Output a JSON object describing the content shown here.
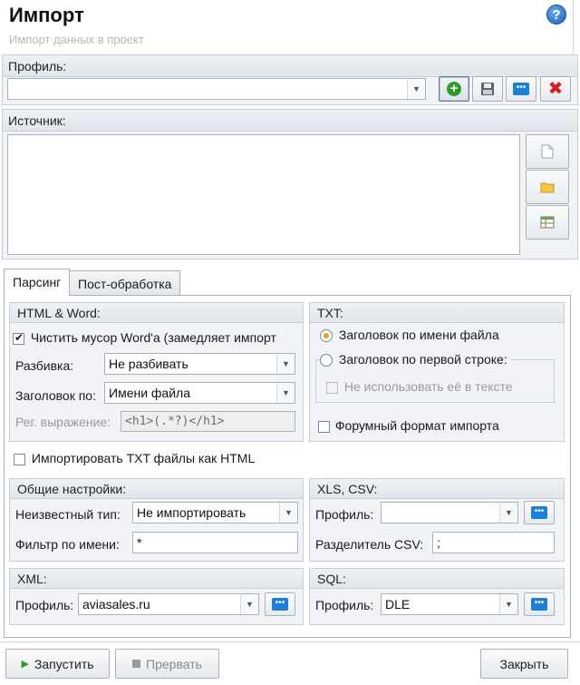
{
  "window": {
    "title": "Импорт",
    "subtitle": "Импорт данных в проект",
    "help_icon": "help-icon"
  },
  "profile": {
    "label": "Профиль:",
    "value": "",
    "buttons": [
      "add-icon",
      "save-icon",
      "more-icon",
      "delete-icon"
    ]
  },
  "source": {
    "label": "Источник:",
    "text": "",
    "buttons": [
      "new-file-icon",
      "open-folder-icon",
      "table-icon"
    ]
  },
  "tabs": {
    "parsing": "Парсинг",
    "post": "Пост-обработка"
  },
  "html_word": {
    "title": "HTML & Word:",
    "clean_label": "Чистить мусор Word'a (замедляет импорт",
    "clean_checked": true,
    "split_label": "Разбивка:",
    "split_value": "Не разбивать",
    "heading_label": "Заголовок по:",
    "heading_value": "Имени файла",
    "regex_label": "Рег. выражение:",
    "regex_value": "<h1>(.*?)</h1>"
  },
  "txt": {
    "title": "TXT:",
    "by_filename": "Заголовок по имени файла",
    "by_filename_checked": true,
    "by_first_line": "Заголовок по первой строке:",
    "by_first_line_checked": false,
    "dont_use": "Не использовать её в тексте",
    "forum_format": "Форумный формат импорта",
    "forum_checked": false
  },
  "import_txt_html": {
    "label": "Импортировать TXT файлы как HTML",
    "checked": false
  },
  "general": {
    "title": "Общие настройки:",
    "unknown_label": "Неизвестный тип:",
    "unknown_value": "Не импортировать",
    "filter_label": "Фильтр по имени:",
    "filter_value": "*"
  },
  "xls_csv": {
    "title": "XLS, CSV:",
    "profile_label": "Профиль:",
    "profile_value": "",
    "separator_label": "Разделитель CSV:",
    "separator_value": ";"
  },
  "xml": {
    "title": "XML:",
    "profile_label": "Профиль:",
    "profile_value": "aviasales.ru"
  },
  "sql": {
    "title": "SQL:",
    "profile_label": "Профиль:",
    "profile_value": "DLE"
  },
  "footer": {
    "run": "Запустить",
    "stop": "Прервать",
    "close": "Закрыть"
  },
  "colors": {
    "add": "#2e9a2e",
    "delete": "#d42020",
    "more": "#1e7fd6",
    "radio_dot": "#e0a020"
  }
}
